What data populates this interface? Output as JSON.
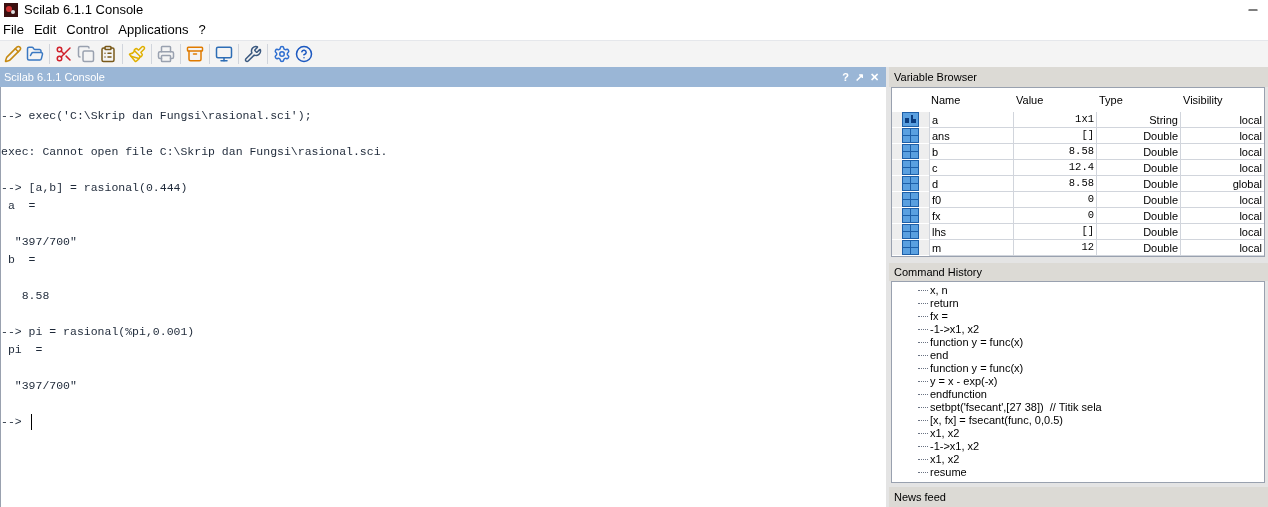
{
  "window": {
    "title": "Scilab 6.1.1 Console"
  },
  "menu": [
    "File",
    "Edit",
    "Control",
    "Applications",
    "?"
  ],
  "toolbar": [
    {
      "kind": "editor"
    },
    {
      "kind": "open"
    },
    {
      "kind": "sep"
    },
    {
      "kind": "cut"
    },
    {
      "kind": "copy",
      "disabled": true
    },
    {
      "kind": "paste"
    },
    {
      "kind": "sep"
    },
    {
      "kind": "clear"
    },
    {
      "kind": "sep"
    },
    {
      "kind": "print",
      "disabled": true
    },
    {
      "kind": "sep"
    },
    {
      "kind": "box"
    },
    {
      "kind": "sep"
    },
    {
      "kind": "console"
    },
    {
      "kind": "sep"
    },
    {
      "kind": "tools"
    },
    {
      "kind": "sep"
    },
    {
      "kind": "gear"
    },
    {
      "kind": "help"
    }
  ],
  "console": {
    "title": "Scilab 6.1.1 Console",
    "controls": [
      "?",
      "↗",
      "✕"
    ],
    "blocks": [
      [
        "--> exec('C:\\Skrip dan Fungsi\\rasional.sci');"
      ],
      [
        "exec: Cannot open file C:\\Skrip dan Fungsi\\rasional.sci."
      ],
      [
        "--> [a,b] = rasional(0.444)",
        " a  ="
      ],
      [
        "  \"397/700\"",
        " b  ="
      ],
      [
        "   8.58"
      ],
      [
        "--> pi = rasional(%pi,0.001)",
        " pi  ="
      ],
      [
        "  \"397/700\""
      ]
    ],
    "prompt": "-->"
  },
  "variable_browser": {
    "title": "Variable Browser",
    "columns": [
      "Name",
      "Value",
      "Type",
      "Visibility"
    ],
    "rows": [
      {
        "kind": "string",
        "name": "a",
        "value": "1x1",
        "type": "String",
        "visibility": "local"
      },
      {
        "kind": "matrix",
        "name": "ans",
        "value": "[]",
        "type": "Double",
        "visibility": "local"
      },
      {
        "kind": "matrix",
        "name": "b",
        "value": "8.58",
        "type": "Double",
        "visibility": "local"
      },
      {
        "kind": "matrix",
        "name": "c",
        "value": "12.4",
        "type": "Double",
        "visibility": "local"
      },
      {
        "kind": "matrix",
        "name": "d",
        "value": "8.58",
        "type": "Double",
        "visibility": "global"
      },
      {
        "kind": "matrix",
        "name": "f0",
        "value": "0",
        "type": "Double",
        "visibility": "local"
      },
      {
        "kind": "matrix",
        "name": "fx",
        "value": "0",
        "type": "Double",
        "visibility": "local"
      },
      {
        "kind": "matrix",
        "name": "lhs",
        "value": "[]",
        "type": "Double",
        "visibility": "local"
      },
      {
        "kind": "matrix",
        "name": "m",
        "value": "12",
        "type": "Double",
        "visibility": "local"
      }
    ]
  },
  "command_history": {
    "title": "Command History",
    "items": [
      "x, n",
      "return",
      "fx =",
      "-1->x1, x2",
      "function y = func(x)",
      "end",
      "function y = func(x)",
      "y = x - exp(-x)",
      "endfunction",
      "setbpt('fsecant',[27 38])  // Titik sela",
      "[x, fx] = fsecant(func, 0,0.5)",
      "x1, x2",
      "-1->x1, x2",
      "x1, x2",
      "resume"
    ]
  },
  "news_feed": {
    "title": "News feed"
  }
}
